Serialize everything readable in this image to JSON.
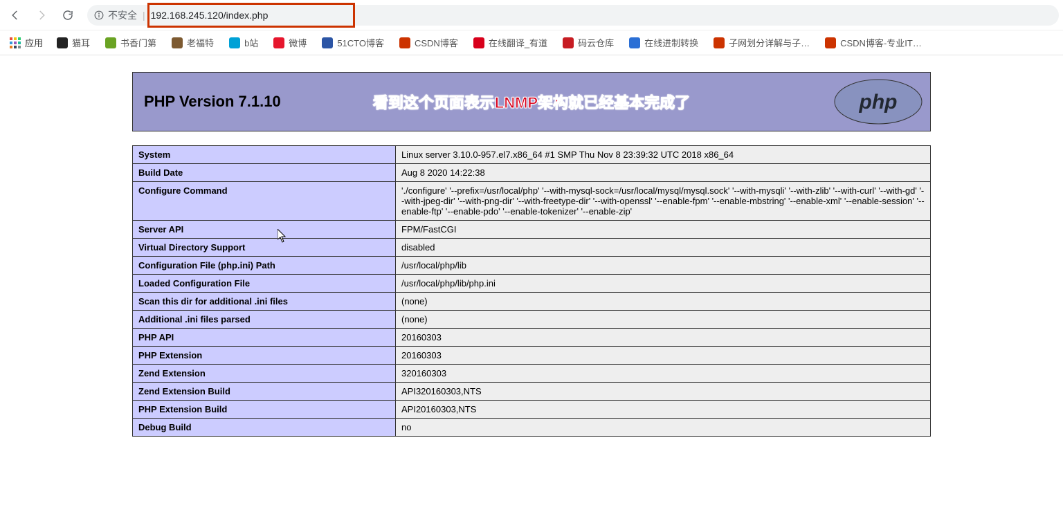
{
  "browser": {
    "security_label": "不安全",
    "url": "192.168.245.120/index.php",
    "apps_label": "应用",
    "bookmarks": [
      {
        "label": "猫耳",
        "color": "#222"
      },
      {
        "label": "书香门第",
        "color": "#6aa323"
      },
      {
        "label": "老福特",
        "color": "#7d5a31"
      },
      {
        "label": "b站",
        "color": "#00a1d6"
      },
      {
        "label": "微博",
        "color": "#e6162d"
      },
      {
        "label": "51CTO博客",
        "color": "#2c55a5"
      },
      {
        "label": "CSDN博客",
        "color": "#c30"
      },
      {
        "label": "在线翻译_有道",
        "color": "#d8001b"
      },
      {
        "label": "码云仓库",
        "color": "#c71d23"
      },
      {
        "label": "在线进制转换",
        "color": "#2b6fd5"
      },
      {
        "label": "子网划分详解与子…",
        "color": "#c30"
      },
      {
        "label": "CSDN博客-专业IT…",
        "color": "#c30"
      }
    ]
  },
  "page": {
    "title": "PHP Version 7.1.10",
    "banner": "看到这个页面表示LNMP架构就已经基本完成了",
    "logo_alt": "php",
    "rows": [
      {
        "k": "System",
        "v": "Linux server 3.10.0-957.el7.x86_64 #1 SMP Thu Nov 8 23:39:32 UTC 2018 x86_64"
      },
      {
        "k": "Build Date",
        "v": "Aug 8 2020 14:22:38"
      },
      {
        "k": "Configure Command",
        "v": "'./configure' '--prefix=/usr/local/php' '--with-mysql-sock=/usr/local/mysql/mysql.sock' '--with-mysqli' '--with-zlib' '--with-curl' '--with-gd' '--with-jpeg-dir' '--with-png-dir' '--with-freetype-dir' '--with-openssl' '--enable-fpm' '--enable-mbstring' '--enable-xml' '--enable-session' '--enable-ftp' '--enable-pdo' '--enable-tokenizer' '--enable-zip'"
      },
      {
        "k": "Server API",
        "v": "FPM/FastCGI"
      },
      {
        "k": "Virtual Directory Support",
        "v": "disabled"
      },
      {
        "k": "Configuration File (php.ini) Path",
        "v": "/usr/local/php/lib"
      },
      {
        "k": "Loaded Configuration File",
        "v": "/usr/local/php/lib/php.ini"
      },
      {
        "k": "Scan this dir for additional .ini files",
        "v": "(none)"
      },
      {
        "k": "Additional .ini files parsed",
        "v": "(none)"
      },
      {
        "k": "PHP API",
        "v": "20160303"
      },
      {
        "k": "PHP Extension",
        "v": "20160303"
      },
      {
        "k": "Zend Extension",
        "v": "320160303"
      },
      {
        "k": "Zend Extension Build",
        "v": "API320160303,NTS"
      },
      {
        "k": "PHP Extension Build",
        "v": "API20160303,NTS"
      },
      {
        "k": "Debug Build",
        "v": "no"
      }
    ]
  }
}
